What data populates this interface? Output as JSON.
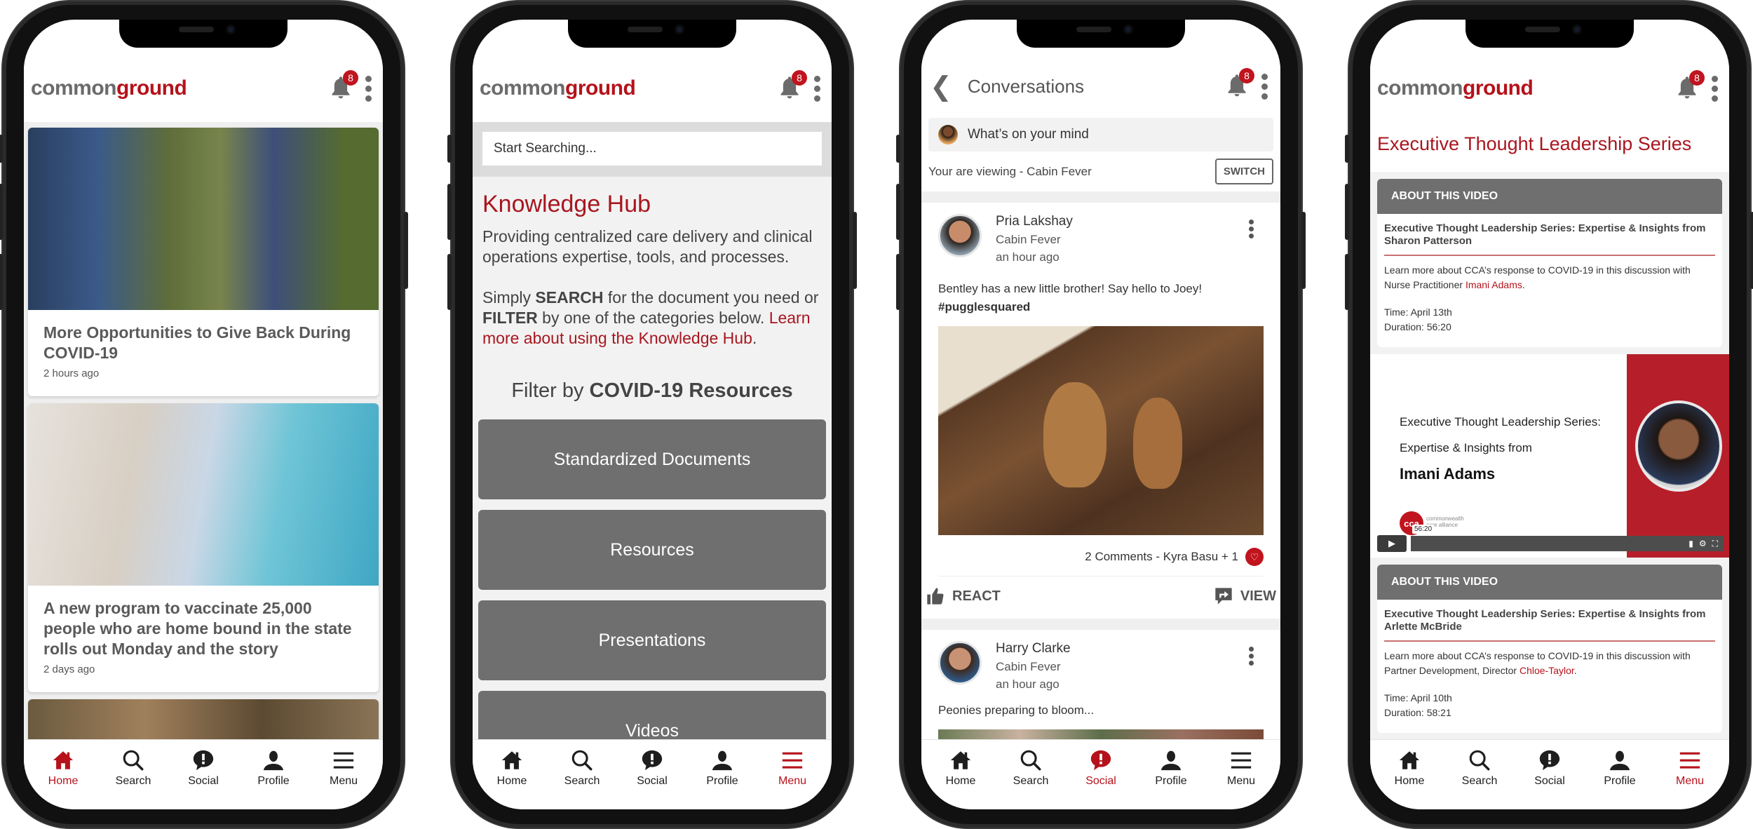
{
  "brand": {
    "logo_part1": "common",
    "logo_part2": "ground",
    "accent_color": "#b5121b",
    "notification_count": "8"
  },
  "nav": {
    "items": [
      {
        "label": "Home",
        "icon": "home-icon"
      },
      {
        "label": "Search",
        "icon": "search-icon"
      },
      {
        "label": "Social",
        "icon": "speech-bubble-alert-icon"
      },
      {
        "label": "Profile",
        "icon": "person-icon"
      },
      {
        "label": "Menu",
        "icon": "hamburger-menu-icon"
      }
    ]
  },
  "screens": {
    "home": {
      "active_nav": "Home",
      "cards": [
        {
          "title": "More Opportunities to Give Back During COVID-19",
          "time": "2 hours ago"
        },
        {
          "title": "A new program to vaccinate 25,000 people who are home bound in the state rolls out Monday and the story",
          "time": "2 days ago"
        }
      ]
    },
    "knowledge_hub": {
      "active_nav": "Menu",
      "search_placeholder": "Start Searching...",
      "title": "Knowledge Hub",
      "description": "Providing centralized care delivery and clinical operations expertise, tools, and processes.",
      "instructions": {
        "prefix": "Simply ",
        "search_word": "SEARCH",
        "middle1": " for the document you need or ",
        "filter_word": "FILTER",
        "middle2": " by one of the categories below. ",
        "link": "Learn more about using the Knowledge Hub",
        "suffix": "."
      },
      "filter_heading_prefix": "Filter by ",
      "filter_heading_bold": "COVID-19 Resources",
      "categories": [
        "Standardized Documents",
        "Resources",
        "Presentations",
        "Videos"
      ]
    },
    "conversations": {
      "active_nav": "Social",
      "title": "Conversations",
      "composer_placeholder": "What’s on your mind",
      "viewing_text": "Your are viewing - Cabin Fever",
      "switch_label": "SWITCH",
      "posts": [
        {
          "author": "Pria Lakshay",
          "group": "Cabin Fever",
          "time": "an hour ago",
          "text": "Bentley has a new little brother! Say hello to Joey!",
          "hashtag": "#pugglesquared",
          "meta": "2 Comments - Kyra Basu + 1",
          "react_label": "REACT",
          "view_label": "VIEW"
        },
        {
          "author": "Harry Clarke",
          "group": "Cabin Fever",
          "time": "an hour ago",
          "text": "Peonies preparing to bloom..."
        }
      ]
    },
    "video_series": {
      "active_nav": "Menu",
      "title": "Executive Thought Leadership Series",
      "videos": [
        {
          "section_label": "ABOUT THIS VIDEO",
          "title": "Executive Thought Leadership Series: Expertise & Insights from Sharon Patterson",
          "desc_prefix": "Learn more about CCA’s response to COVID-19 in this discussion with Nurse Practitioner ",
          "desc_link": "Imani Adams",
          "desc_suffix": ".",
          "time": "Time: April 13th",
          "duration": "Duration: 56:20"
        },
        {
          "section_label": "ABOUT THIS VIDEO",
          "title": "Executive Thought Leadership Series: Expertise & Insights from Arlette McBride",
          "desc_prefix": "Learn more about CCA’s response to COVID-19 in this discussion with Partner Development, Director ",
          "desc_link": "Chloe-Taylor",
          "desc_suffix": ".",
          "time": "Time: April 10th",
          "duration": "Duration: 58:21"
        }
      ],
      "player": {
        "line1": "Executive Thought Leadership Series:",
        "line2": "Expertise & Insights from",
        "name": "Imani Adams",
        "logo_text": "cca",
        "logo_sub1": "commonwealth",
        "logo_sub2": "care alliance",
        "timestamp": "56:20"
      }
    }
  }
}
